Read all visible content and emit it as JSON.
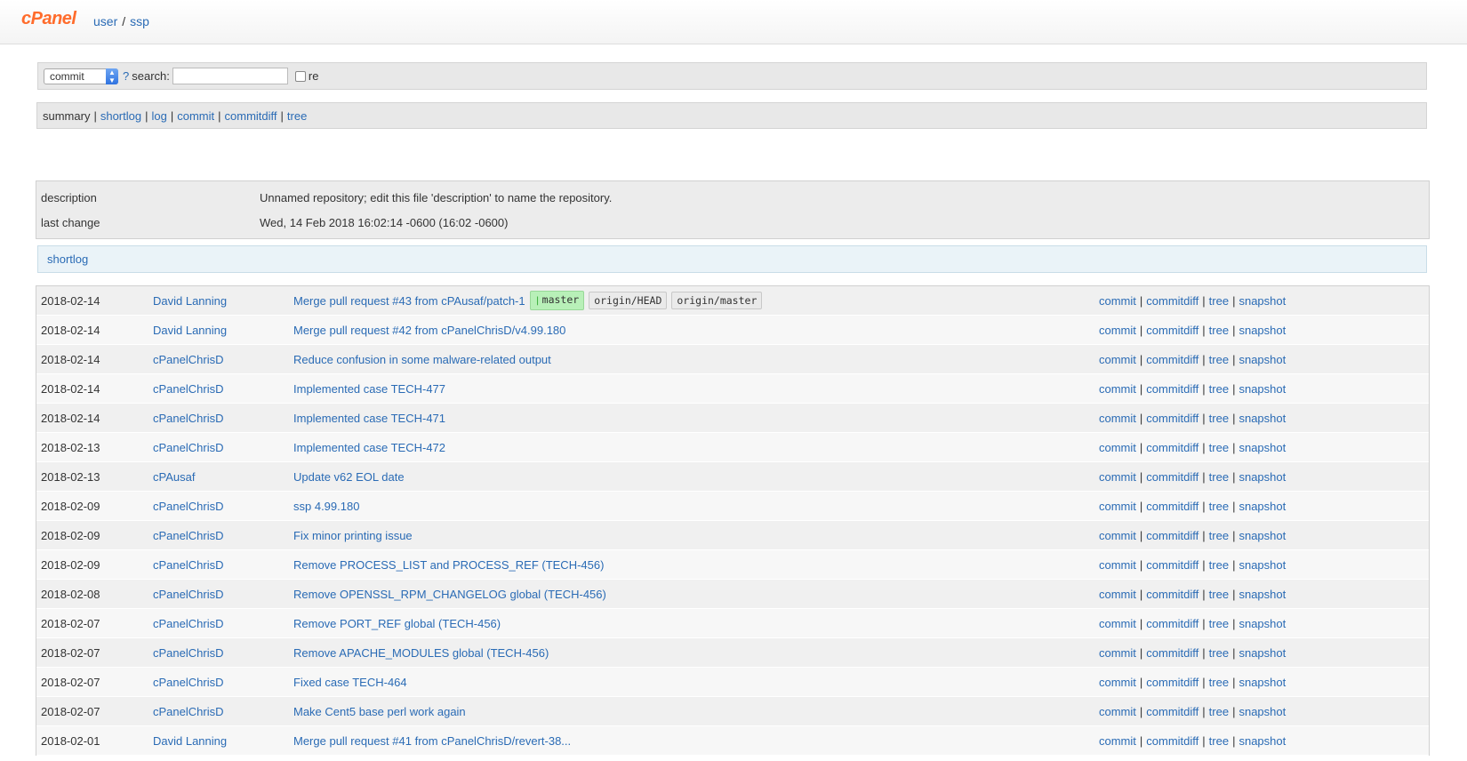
{
  "header": {
    "logo": "cPanel",
    "crumbs": [
      "user",
      "ssp"
    ]
  },
  "search": {
    "type_value": "commit",
    "help": "?",
    "label": "search:",
    "value": "",
    "regex_label": "re"
  },
  "nav": {
    "current": "summary",
    "links": [
      "shortlog",
      "log",
      "commit",
      "commitdiff",
      "tree"
    ]
  },
  "project": {
    "description_label": "description",
    "description_value": "Unnamed repository; edit this file 'description' to name the repository.",
    "last_change_label": "last change",
    "last_change_value": "Wed, 14 Feb 2018 16:02:14 -0600 (16:02 -0600)"
  },
  "shortlog_title": "shortlog",
  "row_links": [
    "commit",
    "commitdiff",
    "tree",
    "snapshot"
  ],
  "commits": [
    {
      "date": "2018-02-14",
      "author": "David Lanning",
      "title": "Merge pull request #43 from cPAusaf/patch-1",
      "refs": [
        {
          "label": "master",
          "head": true
        },
        {
          "label": "origin/HEAD",
          "head": false
        },
        {
          "label": "origin/master",
          "head": false
        }
      ]
    },
    {
      "date": "2018-02-14",
      "author": "David Lanning",
      "title": "Merge pull request #42 from cPanelChrisD/v4.99.180"
    },
    {
      "date": "2018-02-14",
      "author": "cPanelChrisD",
      "title": "Reduce confusion in some malware-related output"
    },
    {
      "date": "2018-02-14",
      "author": "cPanelChrisD",
      "title": "Implemented case TECH-477"
    },
    {
      "date": "2018-02-14",
      "author": "cPanelChrisD",
      "title": "Implemented case TECH-471"
    },
    {
      "date": "2018-02-13",
      "author": "cPanelChrisD",
      "title": "Implemented case TECH-472"
    },
    {
      "date": "2018-02-13",
      "author": "cPAusaf",
      "title": "Update v62 EOL date"
    },
    {
      "date": "2018-02-09",
      "author": "cPanelChrisD",
      "title": "ssp 4.99.180"
    },
    {
      "date": "2018-02-09",
      "author": "cPanelChrisD",
      "title": "Fix minor printing issue"
    },
    {
      "date": "2018-02-09",
      "author": "cPanelChrisD",
      "title": "Remove PROCESS_LIST and PROCESS_REF (TECH-456)"
    },
    {
      "date": "2018-02-08",
      "author": "cPanelChrisD",
      "title": "Remove OPENSSL_RPM_CHANGELOG global (TECH-456)"
    },
    {
      "date": "2018-02-07",
      "author": "cPanelChrisD",
      "title": "Remove PORT_REF global (TECH-456)"
    },
    {
      "date": "2018-02-07",
      "author": "cPanelChrisD",
      "title": "Remove APACHE_MODULES global (TECH-456)"
    },
    {
      "date": "2018-02-07",
      "author": "cPanelChrisD",
      "title": "Fixed case TECH-464"
    },
    {
      "date": "2018-02-07",
      "author": "cPanelChrisD",
      "title": "Make Cent5 base perl work again"
    },
    {
      "date": "2018-02-01",
      "author": "David Lanning",
      "title": "Merge pull request #41 from cPanelChrisD/revert-38..."
    }
  ]
}
